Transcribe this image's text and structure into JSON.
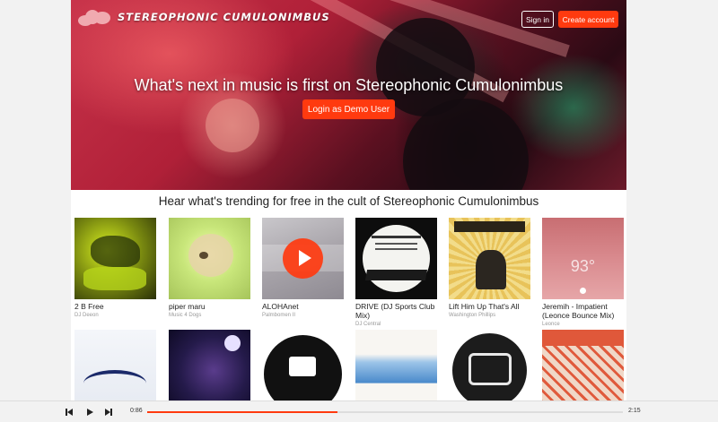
{
  "header": {
    "logo_text": "STEREOPHONIC CUMULONIMBUS",
    "signin_label": "Sign in",
    "create_account_label": "Create account"
  },
  "hero": {
    "headline": "What's next in music is first on Stereophonic Cumulonimbus",
    "demo_button_label": "Login as Demo User"
  },
  "trending": {
    "title": "Hear what's trending for free in the cult of Stereophonic Cumulonimbus",
    "tracks": [
      {
        "title": "2 B Free",
        "artist": "DJ Deeon"
      },
      {
        "title": "piper maru",
        "artist": "Music 4 Dogs"
      },
      {
        "title": "ALOHAnet",
        "artist": "Palmbomen II"
      },
      {
        "title": "DRIVE (DJ Sports Club Mix)",
        "artist": "DJ Central"
      },
      {
        "title": "Lift Him Up That's All",
        "artist": "Washington Phillips"
      },
      {
        "title": "Jeremih - Impatient (Leonce Bounce Mix)",
        "artist": "Leonce"
      }
    ]
  },
  "player": {
    "current_time": "0:86",
    "duration": "2:15",
    "progress": 0.4
  },
  "colors": {
    "accent": "#ff3a0f",
    "text": "#222222",
    "muted": "#999999"
  }
}
